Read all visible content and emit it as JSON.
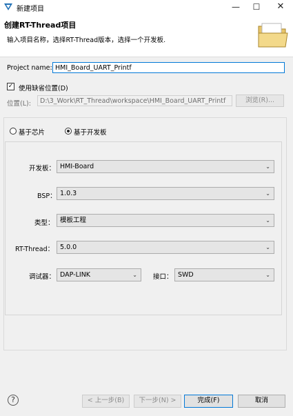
{
  "window": {
    "title": "新建项目",
    "minimize_glyph": "—",
    "maximize_glyph": "☐",
    "close_glyph": "✕"
  },
  "header": {
    "title": "创建RT-Thread项目",
    "description": "输入项目名称，选择RT-Thread版本，选择一个开发板."
  },
  "project": {
    "name_label": "Project name:",
    "name_value": "HMI_Board_UART_Printf",
    "use_default_label": "使用缺省位置(D)",
    "use_default_checked": "✓",
    "location_label": "位置(L):",
    "location_value": "D:\\3_Work\\RT_Thread\\workspace\\HMI_Board_UART_Printf",
    "browse_label": "浏览(R)..."
  },
  "mode": {
    "chip_label": "基于芯片",
    "board_label": "基于开发板",
    "selected": "board"
  },
  "config": {
    "board_label": "开发板：",
    "board_value": "HMI-Board",
    "bsp_label": "BSP：",
    "bsp_value": "1.0.3",
    "type_label": "类型：",
    "type_value": "模板工程",
    "rtthread_label": "RT-Thread：",
    "rtthread_value": "5.0.0",
    "debugger_label": "调试器：",
    "debugger_value": "DAP-LINK",
    "port_label": "接口：",
    "port_value": "SWD"
  },
  "footer": {
    "help_glyph": "?",
    "back_label": "< 上一步(B)",
    "next_label": "下一步(N) >",
    "finish_label": "完成(F)",
    "cancel_label": "取消"
  },
  "icons": {
    "app": "rt-thread-logo-icon",
    "banner": "folder-icon",
    "dropdown": "chevron-down-icon",
    "help": "help-icon"
  },
  "colors": {
    "focus_border": "#0078d7",
    "brand_blue": "#1f6fb5"
  }
}
